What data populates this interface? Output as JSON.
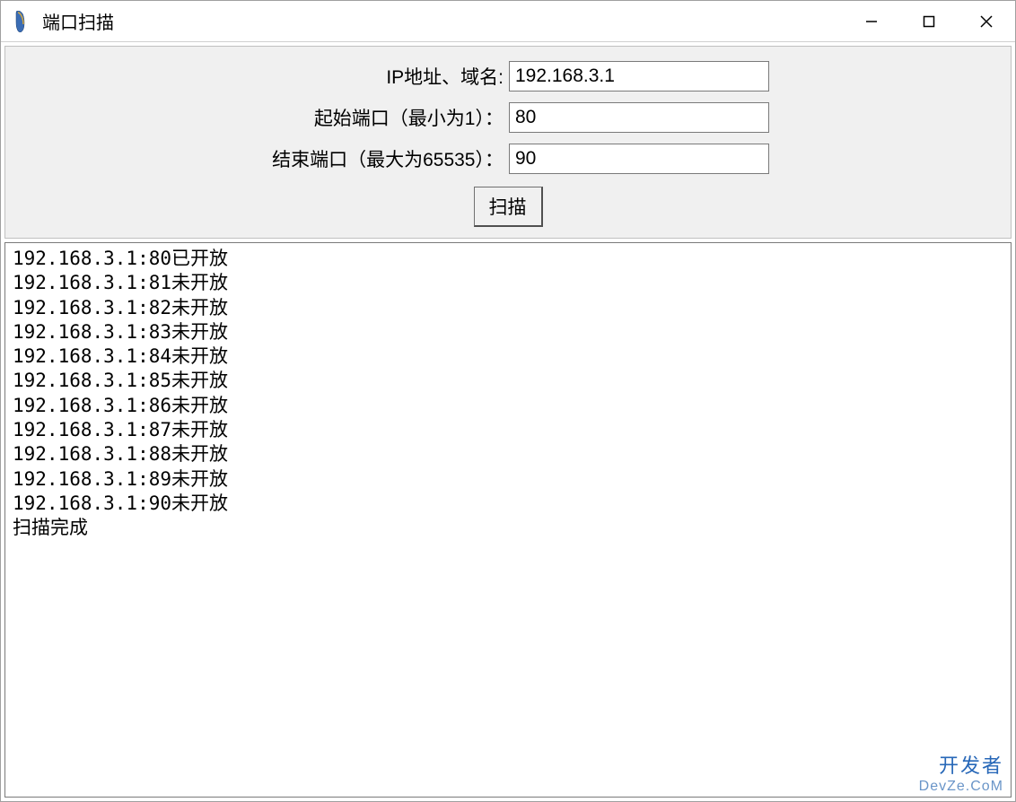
{
  "window": {
    "title": "端口扫描"
  },
  "form": {
    "ip_label": "IP地址、域名:",
    "ip_value": "192.168.3.1",
    "start_port_label": "起始端口（最小为1）：",
    "start_port_value": "80",
    "end_port_label": "结束端口（最大为65535）：",
    "end_port_value": "90",
    "scan_button": "扫描"
  },
  "results": [
    "192.168.3.1:80已开放",
    "192.168.3.1:81未开放",
    "192.168.3.1:82未开放",
    "192.168.3.1:83未开放",
    "192.168.3.1:84未开放",
    "192.168.3.1:85未开放",
    "192.168.3.1:86未开放",
    "192.168.3.1:87未开放",
    "192.168.3.1:88未开放",
    "192.168.3.1:89未开放",
    "192.168.3.1:90未开放",
    "扫描完成"
  ],
  "watermark": {
    "line1": "开发者",
    "line2": "DevZe.CoM"
  }
}
